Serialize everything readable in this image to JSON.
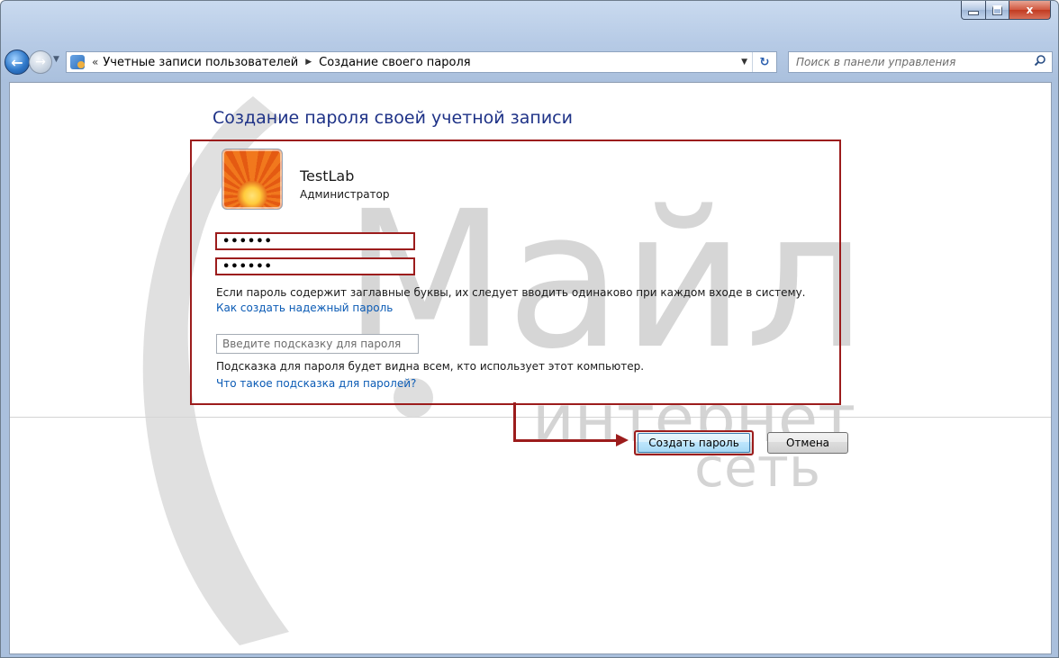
{
  "window": {
    "controls": {
      "minimize_icon": "minimize-icon",
      "maximize_icon": "maximize-icon",
      "close_label": "x"
    }
  },
  "nav": {
    "breadcrumb_prefix": "«",
    "breadcrumb": [
      "Учетные записи пользователей",
      "Создание своего пароля"
    ],
    "breadcrumb_separator": "▶",
    "dropdown_arrow": "▼",
    "refresh_symbol": "↻",
    "search_placeholder": "Поиск в панели управления"
  },
  "page": {
    "title": "Создание пароля своей учетной записи",
    "user_name": "TestLab",
    "user_role": "Администратор",
    "password_mask": "••••••",
    "confirm_mask": "••••••",
    "case_note": "Если пароль содержит заглавные буквы, их следует вводить одинаково при каждом входе в систему.",
    "strong_password_link": "Как создать надежный пароль",
    "hint_placeholder": "Введите подсказку для пароля",
    "hint_note": "Подсказка для пароля будет видна всем, кто использует этот компьютер.",
    "hint_link": "Что такое подсказка для паролей?",
    "create_button": "Создать пароль",
    "cancel_button": "Отмена"
  },
  "watermark": {
    "line1": "Майл",
    "line2": "интернет",
    "line3": "сеть"
  },
  "colors": {
    "accent_red": "#9c1c1c",
    "title_blue": "#1e3287",
    "link_blue": "#0b5bb5"
  }
}
